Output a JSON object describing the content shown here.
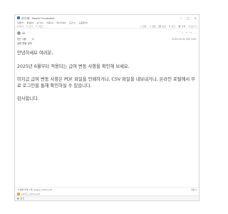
{
  "window": {
    "title": "공지사항 - Mozilla Thunderbird",
    "controls": [
      "–",
      "□",
      "×"
    ]
  },
  "menubar": [
    "파일(F)",
    "편집(E)",
    "보기(V)",
    "이동(G)",
    "메시지(M)",
    "도구(T)",
    "도움말(H)"
  ],
  "toolbar": {
    "left": [
      "✉ 받기",
      "✎ 쓰기",
      "🏷 태그"
    ],
    "right": [
      "↩ 답장",
      "↪ 전달",
      "🗄 보관",
      "⚑ 정크",
      "🗑 삭제",
      "더 보기 ▾"
    ]
  },
  "header": {
    "sender": "HR",
    "to_label": "받는 사람",
    "to_value": "나",
    "date": "2025-05-30 오후 2:05",
    "subject": "급여 변동 공지"
  },
  "body": [
    "안녕하세요 여러분,",
    "2025년 6월부터 적용되는 급여 변동 사항을 확인해 보세요.",
    "미지급 급여 변동 사항은 PDF 파일을 인쇄하거나, CSV 파일을 내보내거나, 온라인 포털에서 무료 로그인을 통해 확인하실 수 있습니다.",
    "감사합니다."
  ],
  "attachments": {
    "summary": "첨부 파일 1개: salary_notice.pdf",
    "file": "salary_notice.pdf",
    "save_label": "저장 ▾"
  },
  "statusbar": {
    "text": "완료"
  },
  "colors": {
    "accent": "#2e6fd6",
    "attachment": "#f5a623"
  }
}
